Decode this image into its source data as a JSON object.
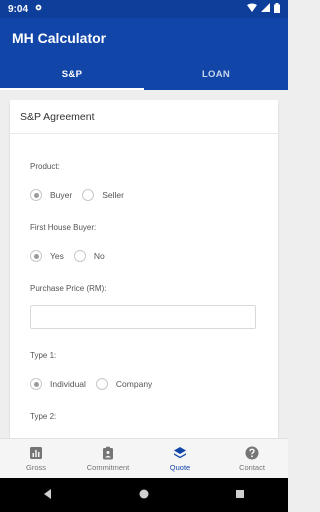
{
  "statusbar": {
    "time": "9:04"
  },
  "appbar": {
    "title": "MH Calculator"
  },
  "tabs": [
    {
      "label": "S&P",
      "active": true
    },
    {
      "label": "LOAN",
      "active": false
    }
  ],
  "card": {
    "title": "S&P Agreement"
  },
  "form": {
    "product": {
      "label": "Product:",
      "options": [
        "Buyer",
        "Seller"
      ],
      "selected": "Buyer"
    },
    "first_house": {
      "label": "First House Buyer:",
      "options": [
        "Yes",
        "No"
      ],
      "selected": "Yes"
    },
    "price": {
      "label": "Purchase Price (RM):",
      "value": ""
    },
    "type1": {
      "label": "Type 1:",
      "options": [
        "Individual",
        "Company"
      ],
      "selected": "Individual"
    },
    "type2": {
      "label": "Type 2:"
    }
  },
  "bottomnav": [
    {
      "label": "Gross",
      "icon": "bar-chart-icon",
      "active": false
    },
    {
      "label": "Commitment",
      "icon": "clipboard-icon",
      "active": false
    },
    {
      "label": "Quote",
      "icon": "layers-icon",
      "active": true
    },
    {
      "label": "Contact",
      "icon": "help-icon",
      "active": false
    }
  ],
  "colors": {
    "primary": "#1146a8",
    "statusbar": "#0d3f9a"
  }
}
